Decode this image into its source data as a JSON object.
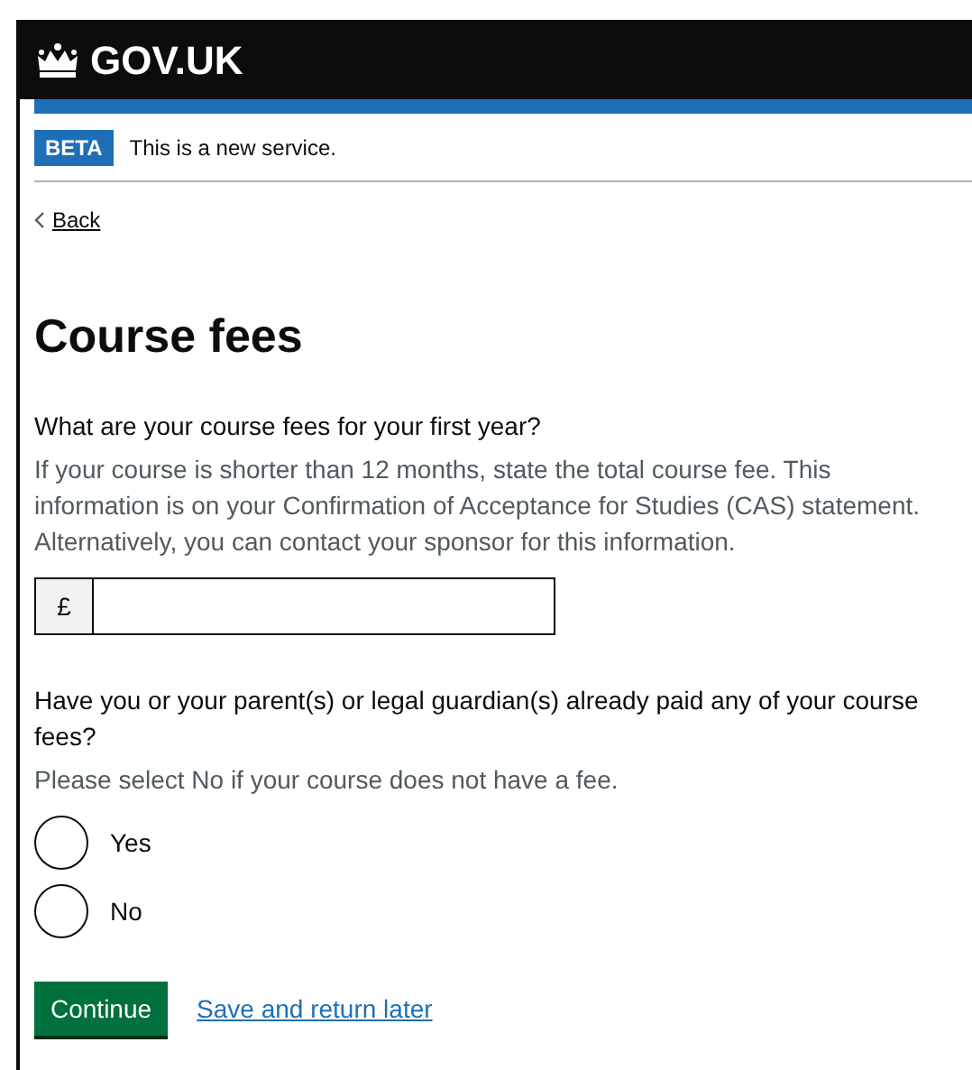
{
  "header": {
    "logo_text": "GOV.UK"
  },
  "phase_banner": {
    "tag": "BETA",
    "text": "This is a new service."
  },
  "back_link": "Back",
  "heading": "Course fees",
  "fee_question": {
    "label": "What are your course fees for your first year?",
    "hint": "If your course is shorter than 12 months, state the total course fee. This information is on your Confirmation of Acceptance for Studies (CAS) statement. Alternatively, you can contact your sponsor for this information.",
    "prefix": "£"
  },
  "paid_question": {
    "label": "Have you or your parent(s) or legal guardian(s) already paid any of your course fees?",
    "hint": "Please select No if your course does not have a fee.",
    "options": [
      {
        "label": "Yes",
        "selected": false
      },
      {
        "label": "No",
        "selected": false
      }
    ]
  },
  "buttons": {
    "primary": "Continue",
    "link": "Save and return later"
  }
}
